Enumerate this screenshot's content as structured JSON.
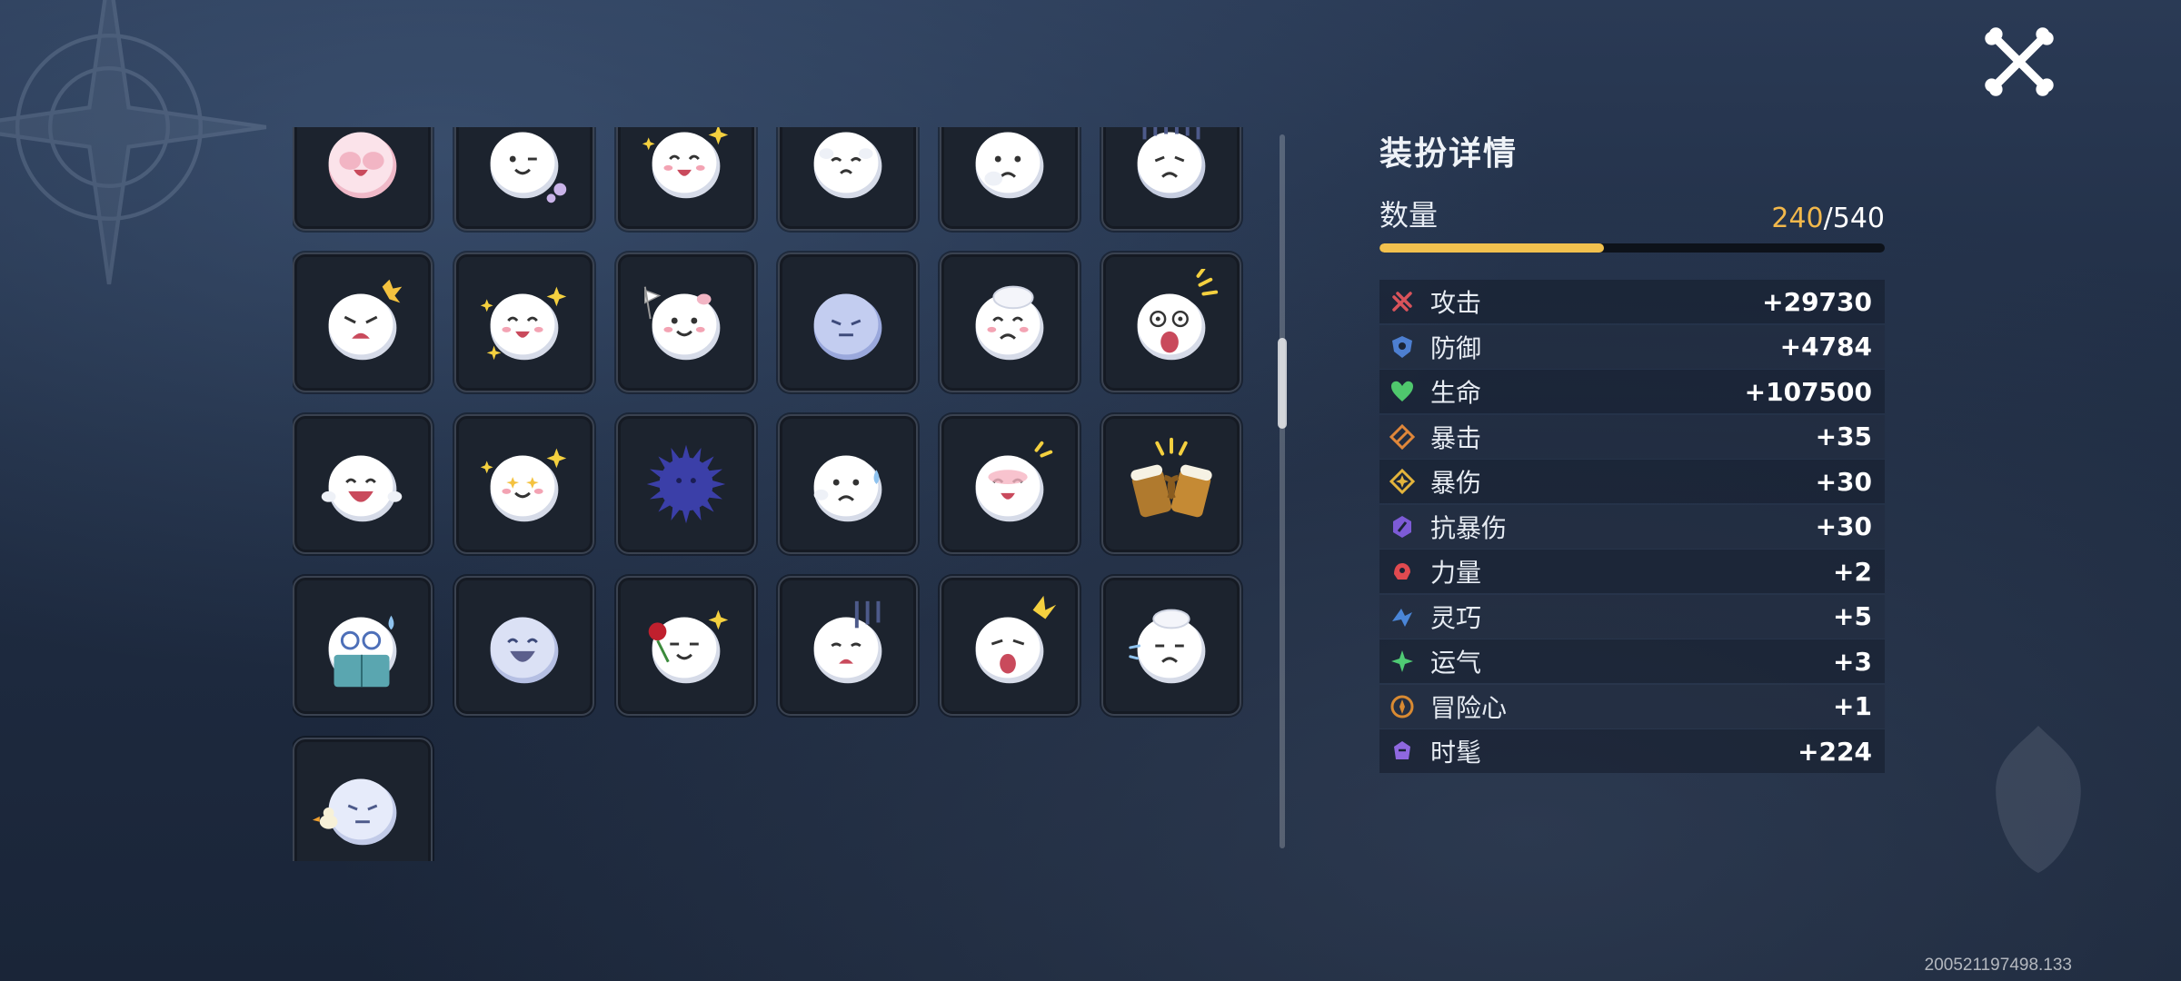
{
  "panel": {
    "title": "装扮详情",
    "count_label": "数量",
    "count_current": "240",
    "count_separator": "/",
    "count_total": "540",
    "progress_fraction": 0.444
  },
  "stats": [
    {
      "name": "攻击",
      "value": "+29730",
      "icon": "attack-icon",
      "color": "#d9535b"
    },
    {
      "name": "防御",
      "value": "+4784",
      "icon": "defense-icon",
      "color": "#4d7fd1"
    },
    {
      "name": "生命",
      "value": "+107500",
      "icon": "health-heart-icon",
      "color": "#4fc86d"
    },
    {
      "name": "暴击",
      "value": "+35",
      "icon": "crit-icon",
      "color": "#e0873a"
    },
    {
      "name": "暴伤",
      "value": "+30",
      "icon": "crit-damage-icon",
      "color": "#e3b43c"
    },
    {
      "name": "抗暴伤",
      "value": "+30",
      "icon": "crit-resist-icon",
      "color": "#7d5bd6"
    },
    {
      "name": "力量",
      "value": "+2",
      "icon": "strength-icon",
      "color": "#e04a50"
    },
    {
      "name": "灵巧",
      "value": "+5",
      "icon": "agility-icon",
      "color": "#4a86d8"
    },
    {
      "name": "运气",
      "value": "+3",
      "icon": "luck-icon",
      "color": "#4fcb74"
    },
    {
      "name": "冒险心",
      "value": "+1",
      "icon": "adventure-icon",
      "color": "#d98a32"
    },
    {
      "name": "时髦",
      "value": "+224",
      "icon": "fashion-icon",
      "color": "#8f68e0"
    }
  ],
  "emotes": [
    "pink-ghost-covering-face",
    "ghost-winking-bubbles",
    "ghost-happy-sparkle",
    "ghost-crying-hands",
    "ghost-thinking",
    "ghost-gloomy-lines",
    "ghost-angry",
    "ghost-sparkle-smile",
    "ghost-waving-flag",
    "ghost-sleepy-blue",
    "ghost-hand-on-head",
    "ghost-shocked",
    "ghost-laughing",
    "ghost-starry-eyes",
    "spiky-dark-ball",
    "ghost-sweating",
    "ghost-blushing",
    "beer-mugs-cheers",
    "ghost-reading-book",
    "ghost-laughing-blue",
    "ghost-with-rose",
    "ghost-despair-lines",
    "ghost-surprised",
    "ghost-sulking",
    "ghost-with-duck"
  ],
  "version": "200521197498.133",
  "colors": {
    "accent": "#f2b84b",
    "tile_border": "#3a4250"
  }
}
